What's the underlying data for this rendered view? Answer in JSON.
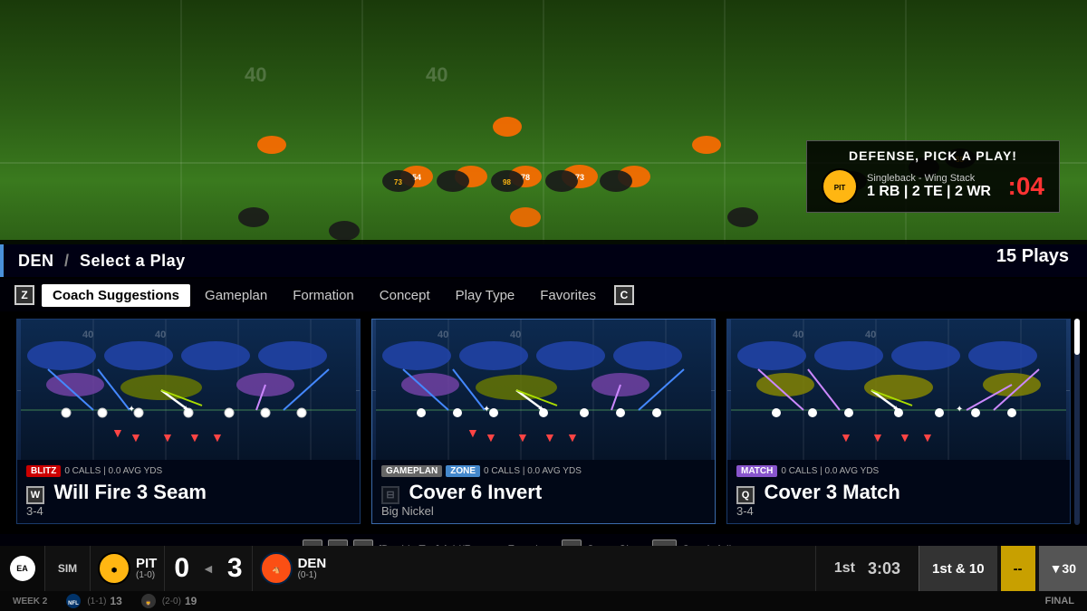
{
  "field": {
    "background_color": "#3a6a22"
  },
  "offense_banner": {
    "title": "DEFENSE, PICK A PLAY!",
    "formation": "Singleback - Wing Stack",
    "personnel": "1 RB | 2 TE | 2 WR",
    "timer": ":04",
    "team": "PIT"
  },
  "select_header": {
    "team": "DEN",
    "divider": "/",
    "action": "Select a Play"
  },
  "plays_count": "15 Plays",
  "nav": {
    "key_z": "Z",
    "key_c": "C",
    "tabs": [
      {
        "label": "Coach Suggestions",
        "active": true
      },
      {
        "label": "Gameplan",
        "active": false
      },
      {
        "label": "Formation",
        "active": false
      },
      {
        "label": "Concept",
        "active": false
      },
      {
        "label": "Play Type",
        "active": false
      },
      {
        "label": "Favorites",
        "active": false
      }
    ]
  },
  "play_cards": [
    {
      "key": "W",
      "name": "Will Fire 3 Seam",
      "formation": "3-4",
      "badges": [
        {
          "label": "BLITZ",
          "type": "blitz"
        }
      ],
      "stats": "0 CALLS | 0.0 AVG YDS"
    },
    {
      "key": "",
      "name": "Cover 6 Invert",
      "formation": "Big Nickel",
      "badges": [
        {
          "label": "GAMEPLAN",
          "type": "gameplan"
        },
        {
          "label": "ZONE",
          "type": "zone"
        }
      ],
      "stats": "0 CALLS | 0.0 AVG YDS"
    },
    {
      "key": "Q",
      "name": "Cover 3 Match",
      "formation": "3-4",
      "badges": [
        {
          "label": "MATCH",
          "type": "match"
        }
      ],
      "stats": "0 CALLS | 0.0 AVG YDS"
    }
  ],
  "button_hints": [
    {
      "key": "W",
      "label": ""
    },
    {
      "key": "⊟",
      "label": ""
    },
    {
      "key": "Q",
      "label": ""
    },
    {
      "key": "[Double Tap] Add/Remove Favorite",
      "label": ""
    },
    {
      "key": "R",
      "label": "Super Sim"
    },
    {
      "key": "⊟⊟",
      "label": "Coach Adjustments"
    }
  ],
  "score_bar": {
    "mode": "SIM",
    "team1": {
      "abbr": "PIT",
      "record": "(1-0)",
      "score": "0",
      "logo_color": "#ffb612"
    },
    "team2": {
      "abbr": "DEN",
      "record": "(0-1)",
      "score": "3",
      "logo_color": "#fb4f14"
    },
    "quarter": "1st",
    "time": "3:03",
    "down": "1st & 10",
    "field_pos": "--",
    "yard": "▼30"
  },
  "sub_bar": {
    "week": "WEEK 2",
    "team1_record": "(1-1)",
    "team1_score_extra": "13",
    "team2_record": "(2-0)",
    "team2_score_extra": "19",
    "status": "FINAL"
  }
}
